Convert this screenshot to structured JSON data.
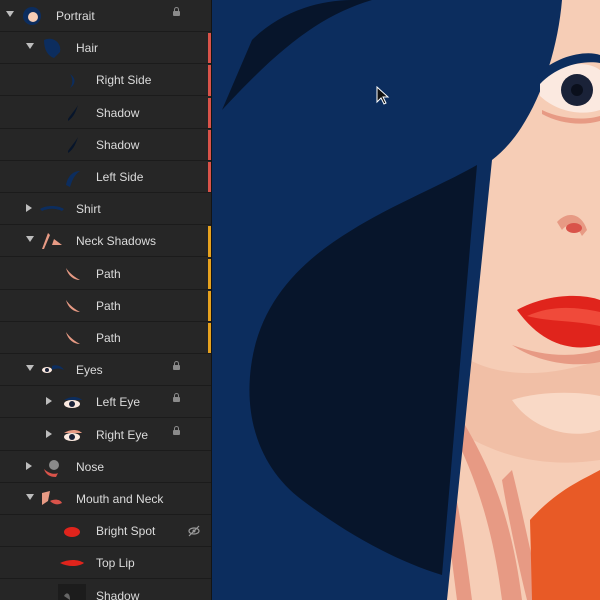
{
  "layers": [
    {
      "label": "Portrait",
      "indent": 0,
      "disclosure": "open",
      "thumb": "portrait-thumbnail",
      "locked": true
    },
    {
      "label": "Hair",
      "indent": 1,
      "disclosure": "open",
      "thumb": "hair-thumbnail",
      "marker": "#d9534a"
    },
    {
      "label": "Right Side",
      "indent": 2,
      "disclosure": "none",
      "thumb": "hair-right-side-thumbnail",
      "marker": "#d9534a"
    },
    {
      "label": "Shadow",
      "indent": 2,
      "disclosure": "none",
      "thumb": "hair-shadow-thumbnail",
      "marker": "#d9534a"
    },
    {
      "label": "Shadow",
      "indent": 2,
      "disclosure": "none",
      "thumb": "hair-shadow-thumbnail",
      "marker": "#d9534a"
    },
    {
      "label": "Left Side",
      "indent": 2,
      "disclosure": "none",
      "thumb": "hair-left-side-thumbnail",
      "marker": "#d9534a"
    },
    {
      "label": "Shirt",
      "indent": 1,
      "disclosure": "closed",
      "thumb": "shirt-thumbnail"
    },
    {
      "label": "Neck Shadows",
      "indent": 1,
      "disclosure": "open",
      "thumb": "neck-shadows-thumbnail",
      "marker": "#e6a21f"
    },
    {
      "label": "Path",
      "indent": 2,
      "disclosure": "none",
      "thumb": "path-thumbnail",
      "marker": "#e6a21f"
    },
    {
      "label": "Path",
      "indent": 2,
      "disclosure": "none",
      "thumb": "path-thumbnail",
      "marker": "#e6a21f"
    },
    {
      "label": "Path",
      "indent": 2,
      "disclosure": "none",
      "thumb": "path-thumbnail",
      "marker": "#e6a21f"
    },
    {
      "label": "Eyes",
      "indent": 1,
      "disclosure": "open",
      "thumb": "eyes-thumbnail",
      "locked": true
    },
    {
      "label": "Left Eye",
      "indent": 2,
      "disclosure": "closed",
      "thumb": "left-eye-thumbnail",
      "locked": true
    },
    {
      "label": "Right Eye",
      "indent": 2,
      "disclosure": "closed",
      "thumb": "right-eye-thumbnail",
      "locked": true
    },
    {
      "label": "Nose",
      "indent": 1,
      "disclosure": "closed",
      "thumb": "nose-thumbnail"
    },
    {
      "label": "Mouth and Neck",
      "indent": 1,
      "disclosure": "open",
      "thumb": "mouth-neck-thumbnail"
    },
    {
      "label": "Bright Spot",
      "indent": 2,
      "disclosure": "none",
      "thumb": "bright-spot-thumbnail",
      "hidden": true
    },
    {
      "label": "Top Lip",
      "indent": 2,
      "disclosure": "none",
      "thumb": "top-lip-thumbnail"
    },
    {
      "label": "Shadow",
      "indent": 2,
      "disclosure": "none",
      "thumb": "shadow-thumbnail"
    }
  ],
  "colors": {
    "panel": "#262626",
    "hair": "#0c2d5e",
    "hair_shadow": "#07152b",
    "skin": "#f6cdb6",
    "skin_shadow": "#e79a84",
    "lip": "#e0241c",
    "accent_orange": "#e85a26",
    "marker_red": "#d9534a",
    "marker_orange": "#e6a21f"
  },
  "icons": {
    "lock": "lock-icon",
    "hidden": "eye-hidden-icon",
    "cursor": "cursor-icon",
    "disclosure_open": "triangle-down-icon",
    "disclosure_closed": "triangle-right-icon"
  }
}
